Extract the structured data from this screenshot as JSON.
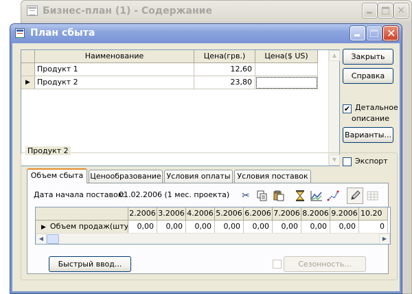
{
  "back_window": {
    "title": "Бизнес-план (1) - Содержание"
  },
  "dialog": {
    "title": "План сбыта",
    "products_table": {
      "columns": [
        "Наименование",
        "Цена(грв.)",
        "Цена($ US)"
      ],
      "rows": [
        {
          "indicator": "",
          "name": "Продукт 1",
          "price_uah": "12,60",
          "price_usd": ""
        },
        {
          "indicator": "▶",
          "name": "Продукт 2",
          "price_uah": "23,80",
          "price_usd": ""
        }
      ]
    },
    "buttons": {
      "close": "Закрыть",
      "help": "Справка",
      "variants": "Варианты..."
    },
    "detail_checkbox": {
      "checked_mark": "✔",
      "label_line1": "Детальное",
      "label_line2": "описание"
    },
    "product_frame_title": "Продукт 2",
    "export_checkbox": {
      "checked_mark": "",
      "label": "Экспорт"
    },
    "tabs": [
      "Объем сбыта",
      "Ценообразование",
      "Условия оплаты",
      "Условия поставок"
    ],
    "start_date": {
      "label": "Дата начала поставок:",
      "value": "01.02.2006 (1 мес. проекта)"
    },
    "toolbar_icons": [
      "scissors-icon",
      "copy-icon",
      "paste-icon",
      "hourglass-icon",
      "line-chart-icon",
      "trend-icon",
      "pencil-icon",
      "grid-disabled-icon"
    ],
    "sales_table": {
      "columns": [
        "2.2006",
        "3.2006",
        "4.2006",
        "5.2006",
        "6.2006",
        "7.2006",
        "8.2006",
        "9.2006",
        "10.20"
      ],
      "row_indicator": "▶",
      "row_label": "Объем продаж(штук)",
      "values": [
        "0,00",
        "0,00",
        "0,00",
        "0,00",
        "0,00",
        "0,00",
        "0,00",
        "0,00",
        "0"
      ]
    },
    "quick_input_button": "Быстрый ввод...",
    "season_checkbox": {
      "checked_mark": ""
    },
    "season_button": "Сезонность..."
  }
}
